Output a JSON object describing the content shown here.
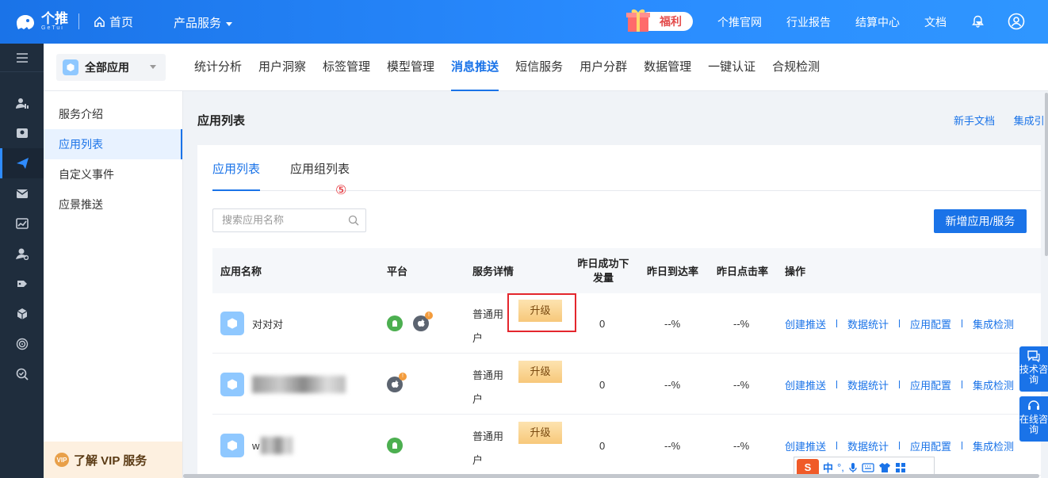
{
  "topbar": {
    "logo_text": "个推",
    "logo_sub": "GeTui",
    "home_label": "首页",
    "product_label": "产品服务",
    "promo_label": "福利",
    "links": [
      "个推官网",
      "行业报告",
      "结算中心",
      "文档"
    ],
    "icons": [
      "home-icon",
      "bell-icon",
      "user-icon"
    ]
  },
  "app_selector": {
    "label": "全部应用"
  },
  "nav_tabs": [
    "统计分析",
    "用户洞察",
    "标签管理",
    "模型管理",
    "消息推送",
    "短信服务",
    "用户分群",
    "数据管理",
    "一键认证",
    "合规检测"
  ],
  "nav_active": "消息推送",
  "subnav": {
    "items": [
      "服务介绍",
      "应用列表",
      "自定义事件",
      "应景推送"
    ],
    "active": "应用列表",
    "vip_label": "了解 VIP 服务",
    "vip_badge": "VIP"
  },
  "page": {
    "title": "应用列表",
    "help_links": [
      "新手文档",
      "集成引"
    ]
  },
  "card": {
    "tabs": [
      "应用列表",
      "应用组列表"
    ],
    "active_tab": "应用列表",
    "search_placeholder": "搜索应用名称",
    "add_button": "新增应用/服务"
  },
  "table": {
    "headers": [
      "应用名称",
      "平台",
      "服务详情",
      "昨日成功下发量",
      "昨日到达率",
      "昨日点击率",
      "操作"
    ],
    "rows": [
      {
        "name": "对对对",
        "platforms": [
          "android",
          "ios"
        ],
        "service_tier": "普通用户",
        "upgrade": "升级",
        "sent": "0",
        "arrival": "--%",
        "click": "--%"
      },
      {
        "name": "",
        "platforms": [
          "ios"
        ],
        "service_tier": "普通用户",
        "upgrade": "升级",
        "sent": "0",
        "arrival": "--%",
        "click": "--%"
      },
      {
        "name": "w",
        "platforms": [
          "android"
        ],
        "service_tier": "普通用户",
        "upgrade": "升级",
        "sent": "0",
        "arrival": "--%",
        "click": "--%"
      }
    ],
    "actions": [
      "创建推送",
      "数据统计",
      "应用配置",
      "集成检测"
    ]
  },
  "annotation": {
    "number": "⑤",
    "color": "#e4262d"
  },
  "float_buttons": [
    {
      "label": "技术咨询",
      "icon": "chat-icon"
    },
    {
      "label": "在线咨询",
      "icon": "headset-icon"
    }
  ],
  "ime_bar": {
    "logo": "S",
    "mode": "中",
    "punct": "°,"
  },
  "colors": {
    "brand": "#1a73e8",
    "sidebar": "#1f2d3d",
    "upgrade": "#f7c87a",
    "vip_bg": "#fdf0e0"
  }
}
